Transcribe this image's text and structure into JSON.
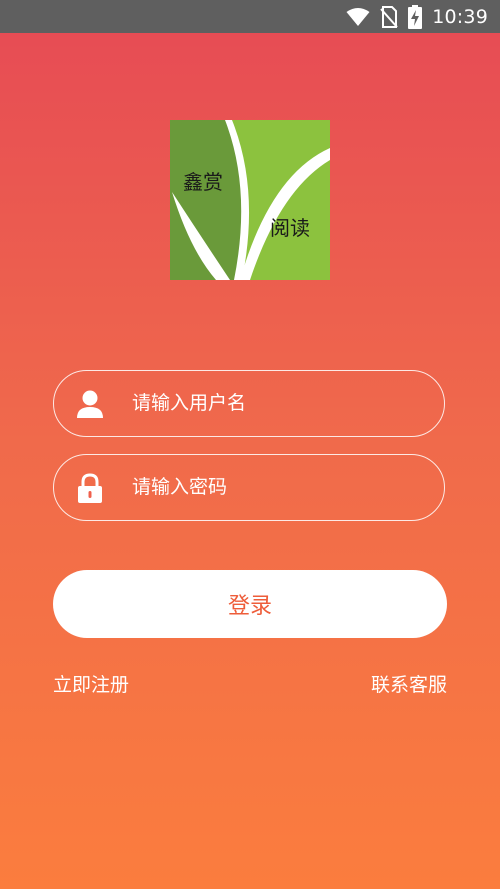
{
  "status_bar": {
    "time": "10:39",
    "icons": [
      "wifi-icon",
      "no-sim-icon",
      "battery-charging-icon"
    ]
  },
  "logo": {
    "line1": "鑫赏",
    "line2": "阅读",
    "colors": {
      "dark_green": "#6a9a3a",
      "light_green": "#8cc23e",
      "white": "#ffffff"
    }
  },
  "form": {
    "username": {
      "placeholder": "请输入用户名",
      "icon": "user-icon"
    },
    "password": {
      "placeholder": "请输入密码",
      "icon": "lock-icon"
    },
    "login_label": "登录"
  },
  "links": {
    "register": "立即注册",
    "contact": "联系客服"
  },
  "colors": {
    "gradient_top": "#e64a55",
    "gradient_bottom": "#fb7d3e",
    "button_text": "#ee5d3a",
    "status_bar": "#5f5f5f"
  }
}
